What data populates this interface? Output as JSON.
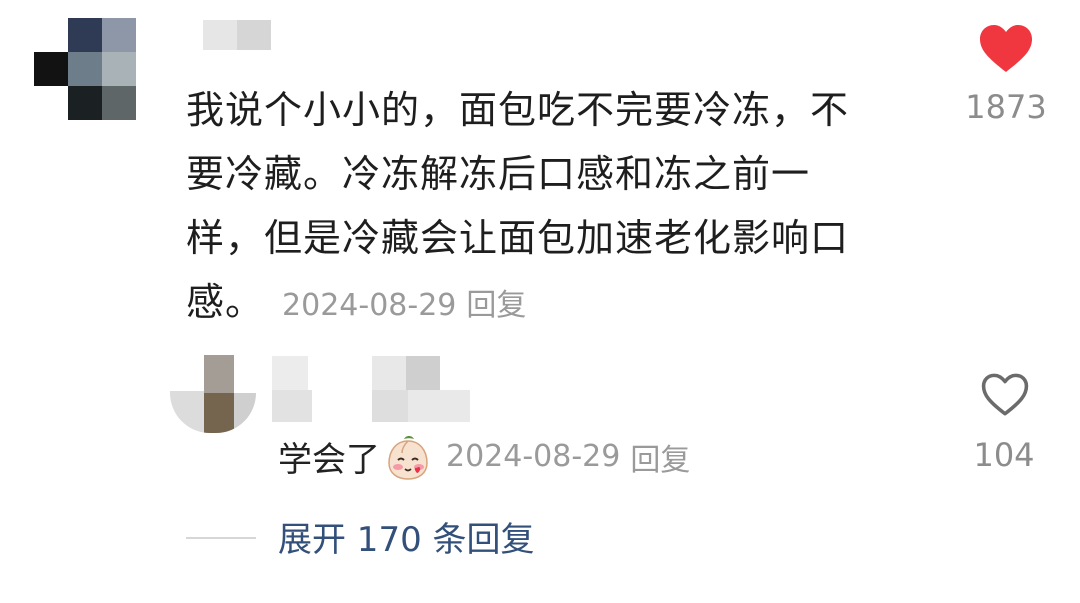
{
  "comment": {
    "text": "我说个小小的，面包吃不完要冷冻，不要冷藏。冷冻解冻后口感和冻之前一样，但是冷藏会让面包加速老化影响口感。",
    "date": "2024-08-29",
    "reply_label": "回复",
    "like_count": "1873",
    "liked": true,
    "like_icon": "heart-filled-icon",
    "like_color": "#f0363f"
  },
  "reply": {
    "text": "学会了",
    "emoji_icon": "peach-emoji-icon",
    "date": "2024-08-29",
    "reply_label": "回复",
    "like_count": "104",
    "like_icon": "heart-outline-icon"
  },
  "expand": {
    "label": "展开 170 条回复"
  }
}
